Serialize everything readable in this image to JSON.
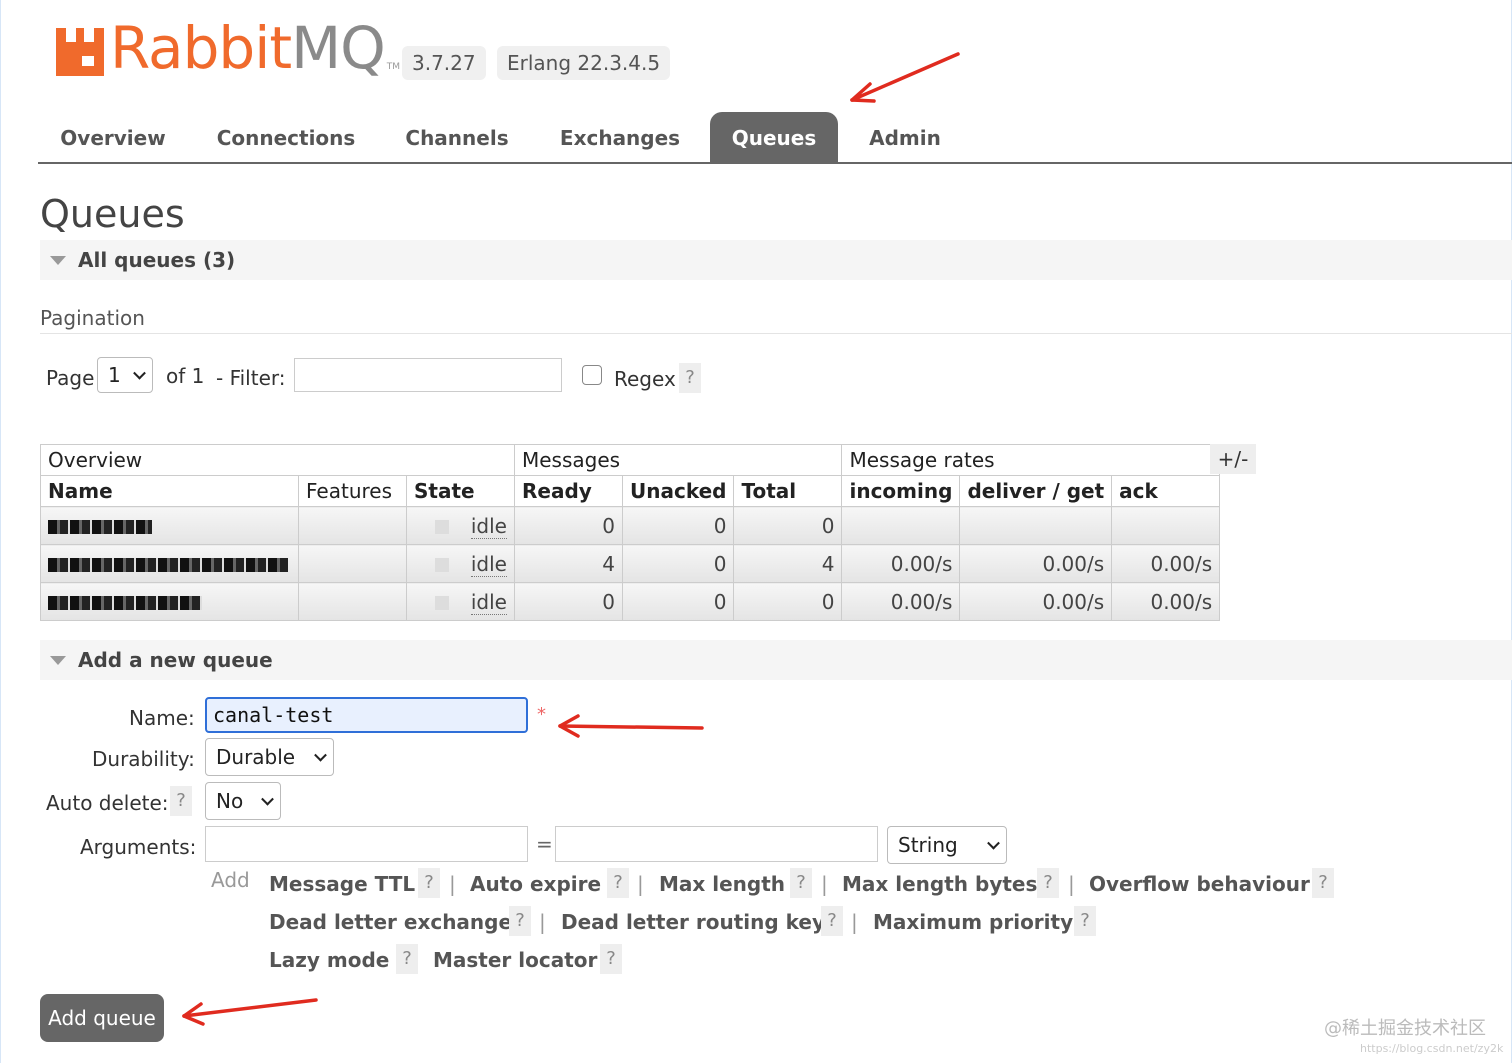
{
  "header": {
    "logo_prefix": "Rabbit",
    "logo_suffix": "MQ",
    "logo_tm": "TM",
    "version": "3.7.27",
    "erlang": "Erlang 22.3.4.5"
  },
  "tabs": [
    {
      "label": "Overview"
    },
    {
      "label": "Connections"
    },
    {
      "label": "Channels"
    },
    {
      "label": "Exchanges"
    },
    {
      "label": "Queues",
      "active": true
    },
    {
      "label": "Admin"
    }
  ],
  "page_title": "Queues",
  "all_queues": {
    "label": "All queues (3)"
  },
  "pagination": {
    "title": "Pagination",
    "page_label": "Page",
    "page_value": "1",
    "of_label": "of 1",
    "filter_label": "- Filter:",
    "filter_value": "",
    "regex_label": "Regex",
    "help": "?"
  },
  "table": {
    "groups": [
      "Overview",
      "Messages",
      "Message rates"
    ],
    "toggle": "+/-",
    "columns": [
      "Name",
      "Features",
      "State",
      "Ready",
      "Unacked",
      "Total",
      "incoming",
      "deliver / get",
      "ack"
    ],
    "rows": [
      {
        "name": "[redacted]",
        "features": "",
        "state": "idle",
        "ready": "0",
        "unacked": "0",
        "total": "0",
        "incoming": "",
        "deliver_get": "",
        "ack": ""
      },
      {
        "name": "[redacted]",
        "features": "",
        "state": "idle",
        "ready": "4",
        "unacked": "0",
        "total": "4",
        "incoming": "0.00/s",
        "deliver_get": "0.00/s",
        "ack": "0.00/s"
      },
      {
        "name": "[redacted]",
        "features": "",
        "state": "idle",
        "ready": "0",
        "unacked": "0",
        "total": "0",
        "incoming": "0.00/s",
        "deliver_get": "0.00/s",
        "ack": "0.00/s"
      }
    ]
  },
  "add_queue": {
    "section_label": "Add a new queue",
    "name_label": "Name:",
    "name_value": "canal-test",
    "required_mark": "*",
    "durability_label": "Durability:",
    "durability_value": "Durable",
    "auto_delete_label": "Auto delete:",
    "auto_delete_value": "No",
    "arguments_label": "Arguments:",
    "equals": "=",
    "arg_type_value": "String",
    "add_label": "Add",
    "arg_links": [
      "Message TTL",
      "Auto expire",
      "Max length",
      "Max length bytes",
      "Overflow behaviour",
      "Dead letter exchange",
      "Dead letter routing key",
      "Maximum priority",
      "Lazy mode",
      "Master locator"
    ],
    "separator": "|",
    "button": "Add queue"
  },
  "watermark": {
    "main": "@稀土掘金技术社区",
    "sub": "https://blog.csdn.net/zy2k"
  },
  "colors": {
    "brand": "#f06a2c",
    "tab_active": "#666666",
    "annotation_arrow": "#e02b1f",
    "focus": "#2f6fd8"
  }
}
